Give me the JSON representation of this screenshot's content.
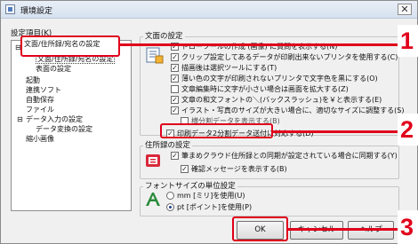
{
  "window": {
    "title": "環境設定",
    "close_glyph": "✕"
  },
  "settings_items": {
    "label": "設定項目(K)",
    "tree": [
      "文面/住所録/宛名の設定",
      "表面の設定",
      "起動",
      "連携ソフト",
      "自動保存",
      "ファイル",
      "データ入力の設定",
      "データ変換の設定",
      "縮小画像"
    ]
  },
  "text_settings": {
    "legend": "文面の設定",
    "items": [
      {
        "label": "ドローツールの作成 (画像) に質問を表示する(N)",
        "checked": true
      },
      {
        "label": "クリップ設定してあるデータが印刷出来ないプリンタを使用する(C)",
        "checked": true
      },
      {
        "label": "描画後は選択ツールにする(T)",
        "checked": true
      },
      {
        "label": "薄い色の文字が印刷されないプリンタで文字色を黒にする(O)",
        "checked": true
      },
      {
        "label": "文章編集時に文字が小さい場合は画面を拡大する(Z)",
        "checked": false
      },
      {
        "label": "文章の和文フォントの＼(バックスラッシュ)を￥と表示する(E)",
        "checked": true
      },
      {
        "label": "イラスト・写真のサイズが大きい場合に、適切なサイズに調整する(S)",
        "checked": true
      },
      {
        "label": "横分割データを表示する(B)",
        "checked": false
      },
      {
        "label": "印刷データ2分割データ送付に対応する(D)",
        "checked": true
      }
    ]
  },
  "address_settings": {
    "legend": "住所録の設定",
    "items": [
      {
        "label": "筆まめクラウド住所録との同期が設定されている場合に同期する(Y)",
        "checked": true
      },
      {
        "label": "確認メッセージを表示する(B)",
        "checked": true
      }
    ]
  },
  "font_unit": {
    "legend": "フォントサイズの単位設定",
    "options": [
      {
        "label": "mm [ミリ]を使用(U)",
        "selected": false
      },
      {
        "label": "pt [ポイント]を使用(P)",
        "selected": true
      }
    ]
  },
  "buttons": {
    "ok": "OK",
    "cancel": "キャンセル",
    "help": "ヘルプ"
  },
  "markers": [
    "1",
    "2",
    "3"
  ],
  "colors": {
    "annotation": "#e0001b",
    "selection": "#3399ff"
  },
  "icons": {
    "text_settings": "document-settings-icon",
    "address_settings": "address-book-icon",
    "font_unit": "font-size-icon"
  }
}
